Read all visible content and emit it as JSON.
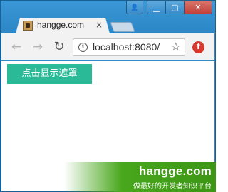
{
  "browser": {
    "tab": {
      "title": "hangge.com",
      "close_glyph": "×",
      "favicon": "site-favicon"
    },
    "window_controls": {
      "user_glyph": "👤",
      "minimize_glyph": "▁",
      "maximize_glyph": "▢",
      "close_glyph": "✕"
    },
    "toolbar": {
      "back_glyph": "←",
      "forward_glyph": "→",
      "reload_glyph": "↻",
      "info_glyph": "i",
      "url": "localhost:8080/",
      "star_glyph": "☆",
      "extension_glyph": "⬆"
    }
  },
  "page": {
    "show_mask_button_label": "点击显示遮罩",
    "button_color": "#2bba97"
  },
  "watermark": {
    "title": "hangge.com",
    "subtitle": "做最好的开发者知识平台"
  }
}
